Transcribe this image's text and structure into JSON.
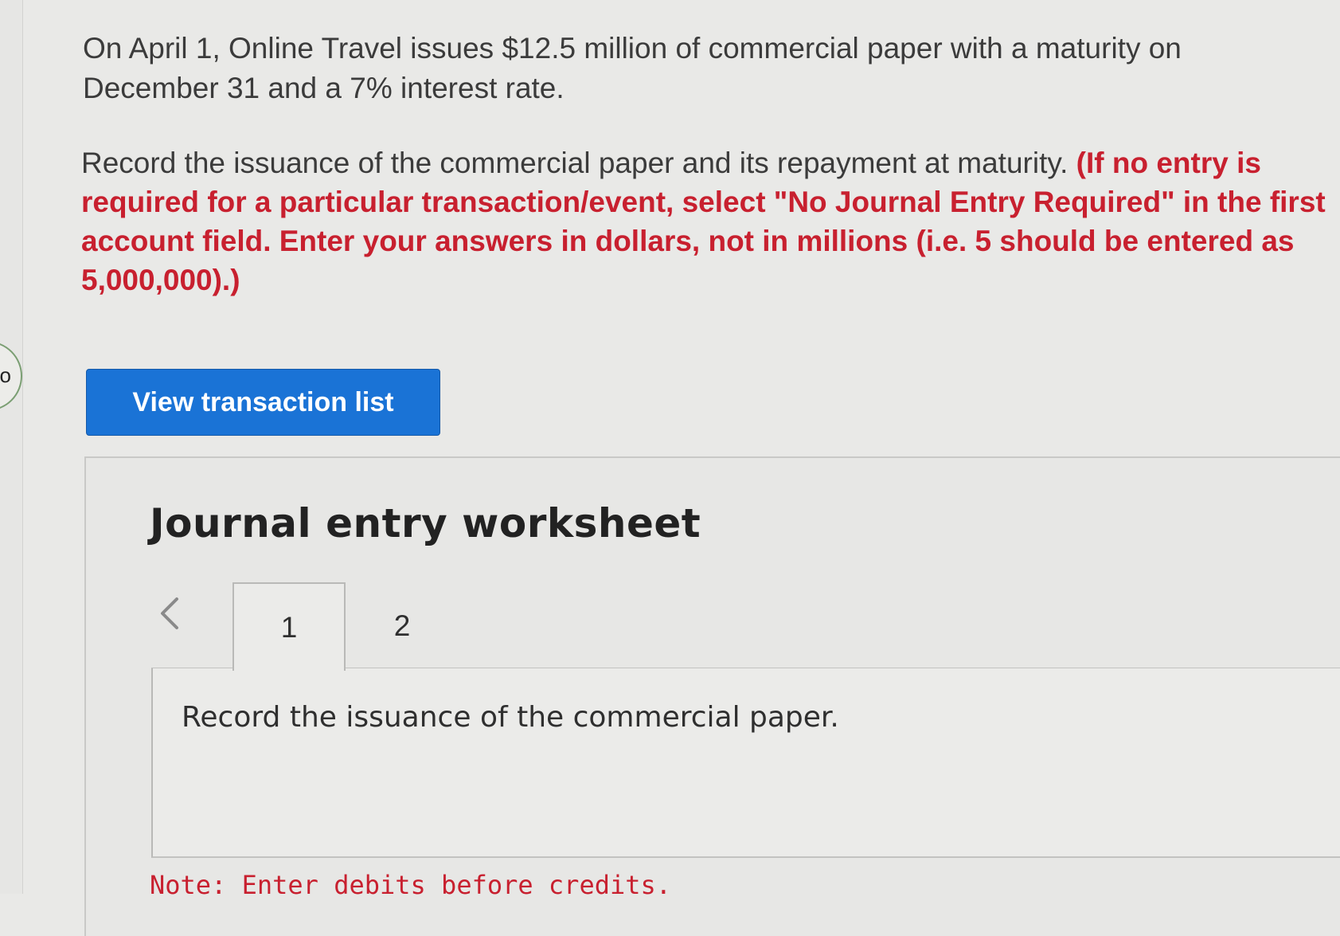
{
  "question": {
    "text": "On April 1, Online Travel issues $12.5 million of commercial paper with a maturity on December 31 and a 7% interest rate."
  },
  "instruction": {
    "lead": "Record the issuance of the commercial paper and its repayment at maturity. ",
    "emphasis": "(If no entry is required for a particular transaction/event, select \"No Journal Entry Required\" in the first account field. Enter your answers in dollars, not in millions (i.e. 5 should be entered as 5,000,000).)"
  },
  "side_tab": {
    "glyph": "o"
  },
  "buttons": {
    "view_transaction_list": "View transaction list"
  },
  "worksheet": {
    "title": "Journal entry worksheet",
    "tabs": [
      {
        "label": "1",
        "active": true
      },
      {
        "label": "2",
        "active": false
      }
    ],
    "prev_icon": "chevron-left-icon",
    "entry_instruction": "Record the issuance of the commercial paper.",
    "note": "Note: Enter debits before credits."
  },
  "colors": {
    "accent": "#1a73d6",
    "emphasis_red": "#c8202f",
    "background": "#e9e9e7"
  }
}
